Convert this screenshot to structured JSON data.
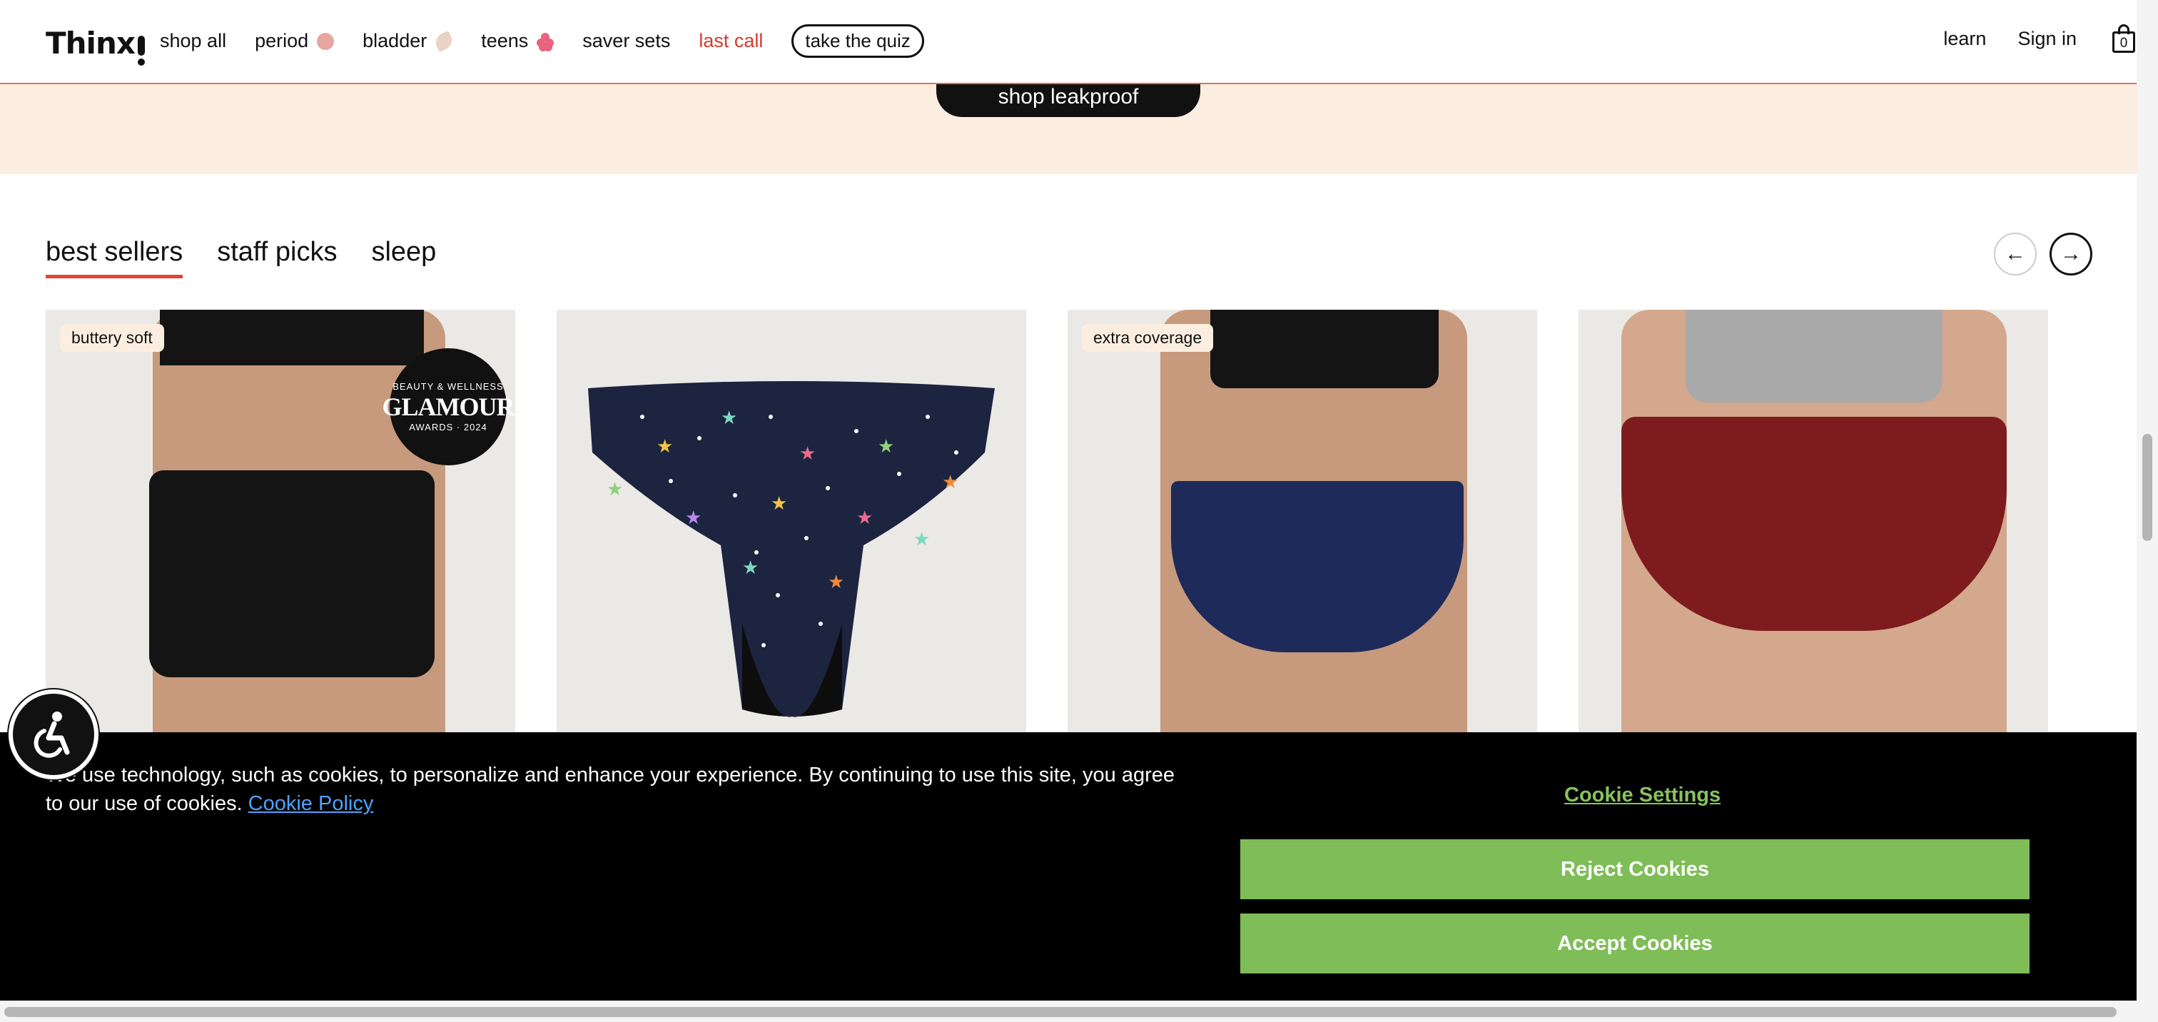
{
  "header": {
    "logo": "Thinx",
    "nav": [
      "shop all",
      "period",
      "bladder",
      "teens",
      "saver sets",
      "last call"
    ],
    "quiz": "take the quiz",
    "learn": "learn",
    "signin": "Sign in",
    "cart_count": "0"
  },
  "banner": {
    "cta": "shop leakproof"
  },
  "tabs": [
    "best sellers",
    "staff picks",
    "sleep"
  ],
  "products": [
    {
      "badge": "buttery soft",
      "award_top": "BEAUTY & WELLNESS",
      "award_name": "GLAMOUR",
      "award_bottom": "AWARDS · 2024"
    },
    {
      "badge": ""
    },
    {
      "badge": "extra coverage"
    },
    {
      "badge": ""
    }
  ],
  "cookie": {
    "text": "We use technology, such as cookies, to personalize and enhance your experience. By continuing to use this site, you agree to our use of cookies.",
    "policy": "Cookie Policy",
    "settings": "Cookie Settings",
    "reject": "Reject Cookies",
    "accept": "Accept Cookies"
  },
  "colors": {
    "accent_red": "#d63a2f",
    "cookie_green": "#7ebd57",
    "banner_bg": "#fbeee0"
  }
}
